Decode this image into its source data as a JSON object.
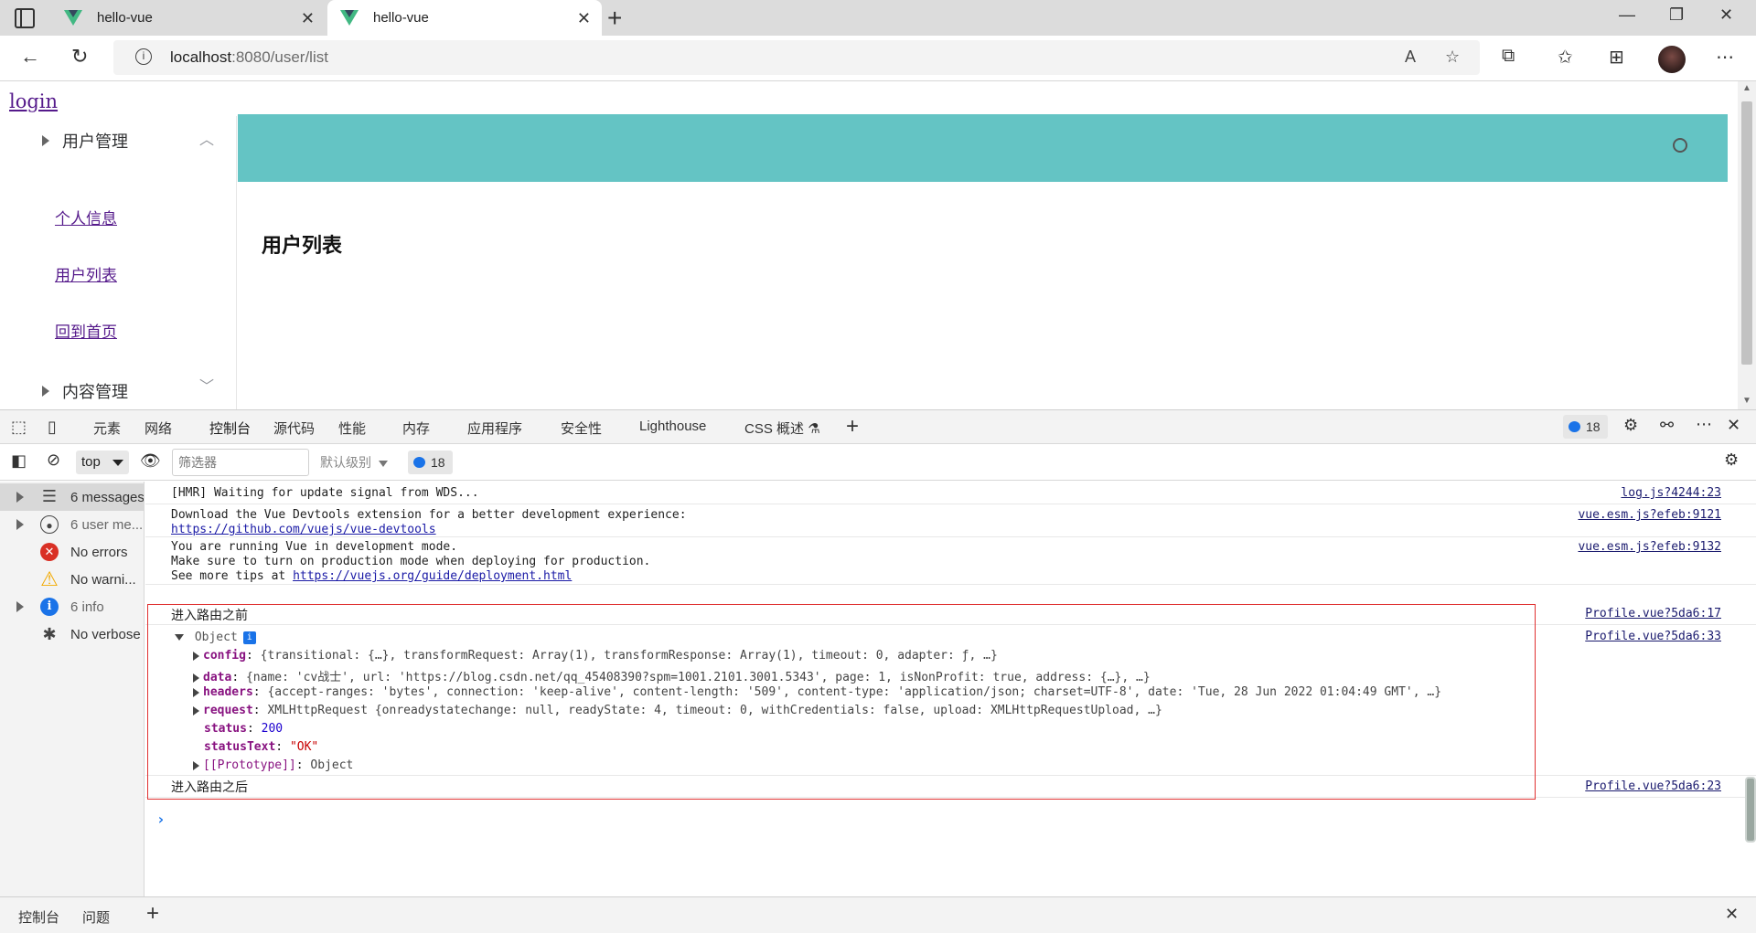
{
  "browser": {
    "tabs": [
      {
        "title": "hello-vue"
      },
      {
        "title": "hello-vue"
      }
    ],
    "address": {
      "host": "localhost",
      "path": ":8080/user/list"
    }
  },
  "page": {
    "login_link": "login",
    "sidebar": {
      "menu1": "用户管理",
      "items": [
        "个人信息",
        "用户列表",
        "回到首页"
      ],
      "menu2": "内容管理"
    },
    "heading": "用户列表"
  },
  "devtools": {
    "tabs": [
      "元素",
      "网络",
      "控制台",
      "源代码",
      "性能",
      "内存",
      "应用程序",
      "安全性",
      "Lighthouse",
      "CSS 概述"
    ],
    "active_tab": "控制台",
    "message_count": "18",
    "context": "top",
    "filter_placeholder": "筛选器",
    "level": "默认级别",
    "sidebar": [
      {
        "label": "6 messages"
      },
      {
        "label": "6 user me..."
      },
      {
        "label": "No errors"
      },
      {
        "label": "No warni..."
      },
      {
        "label": "6 info"
      },
      {
        "label": "No verbose"
      }
    ],
    "messages": [
      {
        "text": "[HMR] Waiting for update signal from WDS...",
        "source": "log.js?4244:23"
      },
      {
        "line1": "Download the Vue Devtools extension for a better development experience:",
        "link": "https://github.com/vuejs/vue-devtools",
        "source": "vue.esm.js?efeb:9121"
      },
      {
        "line1": "You are running Vue in development mode.",
        "line2": "Make sure to turn on production mode when deploying for production.",
        "line3_prefix": "See more tips at ",
        "link": "https://vuejs.org/guide/deployment.html",
        "source": "vue.esm.js?efeb:9132"
      },
      {
        "text": "进入路由之前",
        "source": "Profile.vue?5da6:17"
      },
      {
        "text": "Object",
        "source": "Profile.vue?5da6:33"
      },
      {
        "text": "进入路由之后",
        "source": "Profile.vue?5da6:23"
      }
    ],
    "object": {
      "config": "{transitional: {…}, transformRequest: Array(1), transformResponse: Array(1), timeout: 0, adapter: ƒ, …}",
      "data": "{name: 'cv战士', url: 'https://blog.csdn.net/qq_45408390?spm=1001.2101.3001.5343', page: 1, isNonProfit: true, address: {…}, …}",
      "headers": "{accept-ranges: 'bytes', connection: 'keep-alive', content-length: '509', content-type: 'application/json; charset=UTF-8', date: 'Tue, 28 Jun 2022 01:04:49 GMT', …}",
      "request": "XMLHttpRequest {onreadystatechange: null, readyState: 4, timeout: 0, withCredentials: false, upload: XMLHttpRequestUpload, …}",
      "status": "200",
      "statusText": "\"OK\"",
      "prototype": "Object"
    },
    "drawer_tabs": [
      "控制台",
      "问题"
    ]
  }
}
